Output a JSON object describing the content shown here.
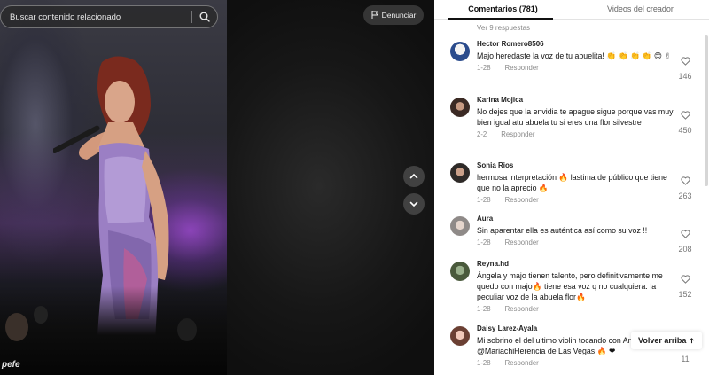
{
  "search": {
    "placeholder": "Buscar contenido relacionado"
  },
  "video": {
    "report_label": "Denunciar",
    "overlay_text": "pefe"
  },
  "panel": {
    "tabs": [
      {
        "label": "Comentarios (781)"
      },
      {
        "label": "Videos del creador"
      }
    ],
    "replies_link": "Ver 9 respuestas",
    "back_to_top": "Volver arriba",
    "comments": [
      {
        "name": "Hector Romero8506",
        "text": "Majo heredaste la voz de tu abuelita! 👏 👏 👏 👏 😊 ✌",
        "date": "1-28",
        "reply": "Responder",
        "likes": "146"
      },
      {
        "name": "Karina Mojica",
        "text": "No dejes que la envidia te apague sigue porque vas muy bien igual atu abuela tu si eres una flor silvestre",
        "date": "2-2",
        "reply": "Responder",
        "likes": "450"
      },
      {
        "name": "Sonia Rios",
        "text": "hermosa interpretación 🔥 lastima de público que tiene que no la aprecio 🔥",
        "date": "1-28",
        "reply": "Responder",
        "likes": "263"
      },
      {
        "name": "Aura",
        "text": "Sin aparentar ella es auténtica así como su voz !!",
        "date": "1-28",
        "reply": "Responder",
        "likes": "208"
      },
      {
        "name": "Reyna.hd",
        "text": "Ángela y majo tienen talento, pero definitivamente me quedo con majo🔥 tiene esa voz q no cualquiera. la peculiar voz de la abuela flor🔥",
        "date": "1-28",
        "reply": "Responder",
        "likes": "152"
      },
      {
        "name": "Daisy Larez-Ayala",
        "text": "Mi sobrino el del ultimo violin tocando con Angela Aguilar @MariachiHerencia de Las Vegas 🔥 ❤",
        "date": "1-28",
        "reply": "Responder",
        "likes": "11"
      }
    ]
  }
}
